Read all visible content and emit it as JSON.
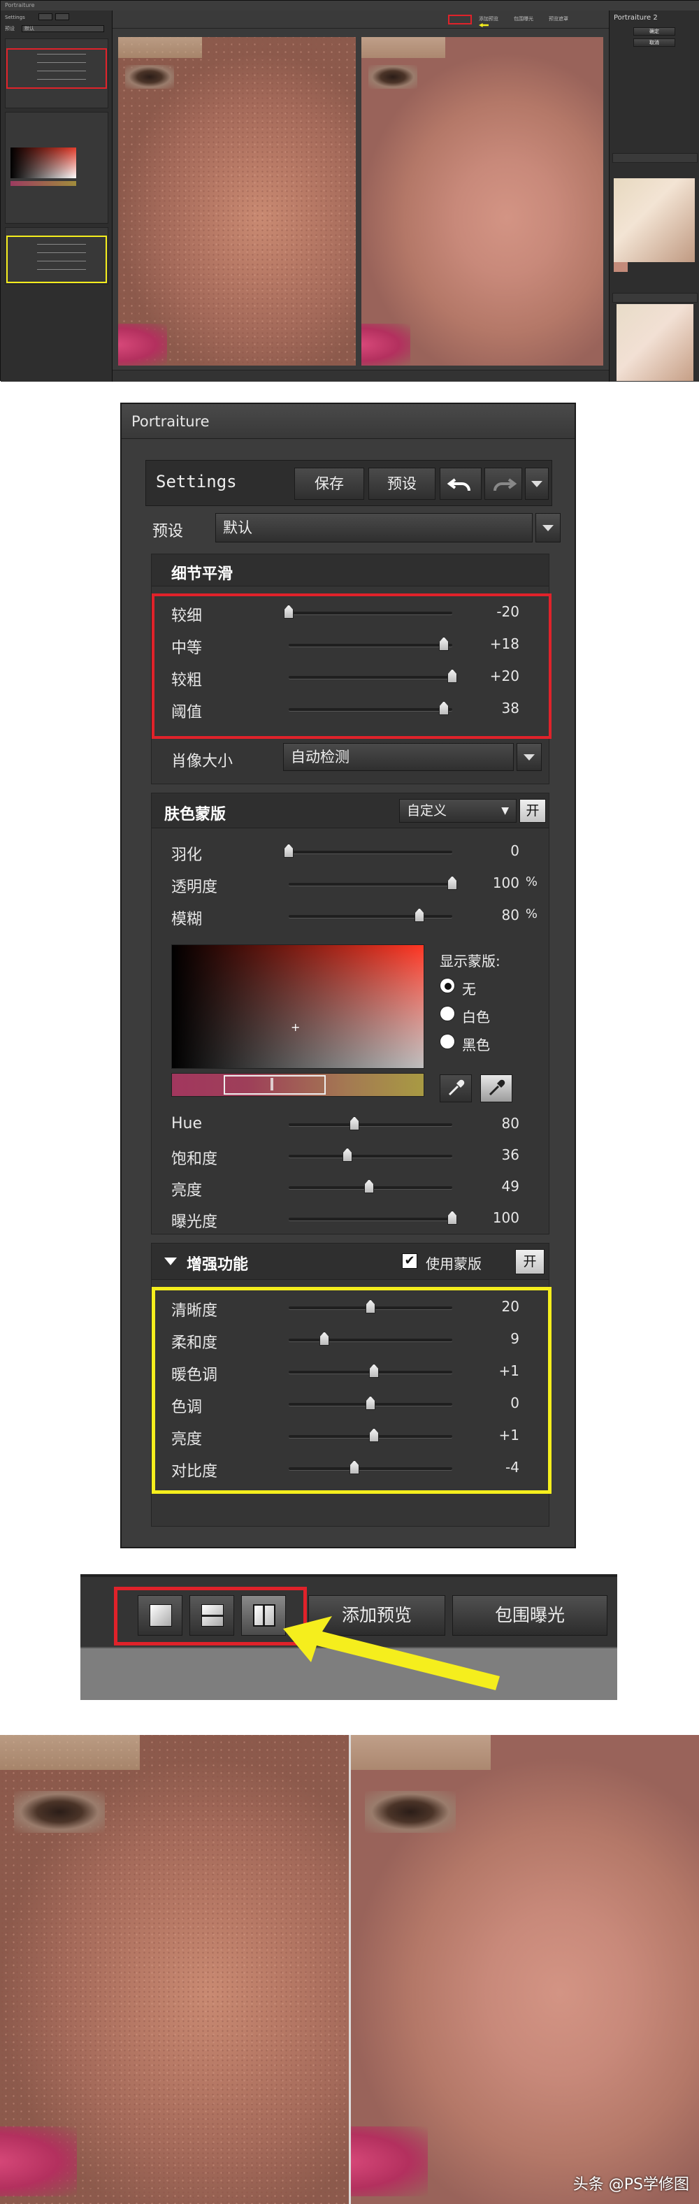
{
  "app": {
    "title": "Portraiture",
    "small_title": "Portraiture",
    "brand_badge": "Portraiture 2"
  },
  "section1": {
    "toolbar_buttons": [
      "添加预览",
      "包围曝光",
      "预览遮罩"
    ],
    "left_settings_label": "Settings",
    "left_preset_label": "预设",
    "left_preset_value": "默认",
    "right_buttons": [
      "确定",
      "取消"
    ],
    "right_preview_label": "Preview"
  },
  "panel": {
    "settings_title": "Settings",
    "save_label": "保存",
    "preset_button_label": "预设",
    "preset_label": "预设",
    "preset_value": "默认",
    "detail": {
      "title": "细节平滑",
      "rows": [
        {
          "label": "较细",
          "value": "-20",
          "pos": 0.0
        },
        {
          "label": "中等",
          "value": "+18",
          "pos": 0.95
        },
        {
          "label": "较粗",
          "value": "+20",
          "pos": 1.0
        },
        {
          "label": "阈值",
          "value": "38",
          "pos": 0.95
        }
      ],
      "portrait_size_label": "肖像大小",
      "portrait_size_value": "自动检测"
    },
    "skin_mask": {
      "title": "肤色蒙版",
      "mode_value": "自定义",
      "toggle_label": "开",
      "rows": [
        {
          "label": "羽化",
          "value": "0",
          "pos": 0.0,
          "unit": ""
        },
        {
          "label": "透明度",
          "value": "100",
          "pos": 1.0,
          "unit": "%"
        },
        {
          "label": "模糊",
          "value": "80",
          "pos": 0.8,
          "unit": "%"
        }
      ],
      "show_mask_label": "显示蒙版:",
      "options": [
        "无",
        "白色",
        "黑色"
      ],
      "selected_option": "无",
      "hsl_rows": [
        {
          "label": "Hue",
          "value": "80",
          "pos": 0.4
        },
        {
          "label": "饱和度",
          "value": "36",
          "pos": 0.36
        },
        {
          "label": "亮度",
          "value": "49",
          "pos": 0.49
        },
        {
          "label": "曝光度",
          "value": "100",
          "pos": 1.0
        }
      ]
    },
    "enhance": {
      "title": "增强功能",
      "use_mask_label": "使用蒙版",
      "use_mask_checked": true,
      "toggle_label": "开",
      "rows": [
        {
          "label": "清晰度",
          "value": "20",
          "pos": 0.5
        },
        {
          "label": "柔和度",
          "value": "9",
          "pos": 0.22
        },
        {
          "label": "暖色调",
          "value": "+1",
          "pos": 0.52
        },
        {
          "label": "色调",
          "value": "0",
          "pos": 0.5
        },
        {
          "label": "亮度",
          "value": "+1",
          "pos": 0.52
        },
        {
          "label": "对比度",
          "value": "-4",
          "pos": 0.4
        }
      ]
    }
  },
  "toolbar_crop": {
    "add_preview_label": "添加预览",
    "bracket_label": "包围曝光"
  },
  "watermark": "头条 @PS学修图",
  "colors": {
    "highlight_red": "#e0222a",
    "highlight_yellow": "#f5ee1d"
  }
}
